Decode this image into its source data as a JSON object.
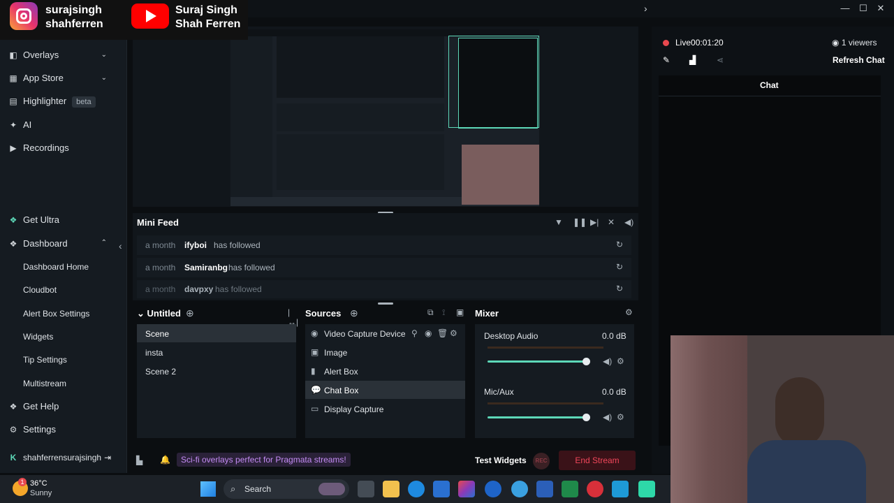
{
  "overlay": {
    "instagram_name": [
      "surajsingh",
      "shahferren"
    ],
    "youtube_name": [
      "Suraj Singh",
      "Shah Ferren"
    ]
  },
  "window": {
    "min": "—",
    "max": "☐",
    "close": "✕"
  },
  "sidebar": {
    "items": [
      {
        "label": "Overlays",
        "icon": "overlays-icon"
      },
      {
        "label": "App Store",
        "icon": "app-store-icon"
      },
      {
        "label": "Highlighter",
        "icon": "highlighter-icon",
        "badge": "beta"
      },
      {
        "label": "AI",
        "icon": "ai-sparkle-icon"
      },
      {
        "label": "Recordings",
        "icon": "recordings-icon"
      }
    ],
    "bottom": {
      "get_ultra": "Get Ultra",
      "dashboard": "Dashboard",
      "sub": [
        "Dashboard Home",
        "Cloudbot",
        "Alert Box Settings",
        "Widgets",
        "Tip Settings",
        "Multistream"
      ],
      "get_help": "Get Help",
      "settings": "Settings",
      "user": "shahferrensurajsingh"
    }
  },
  "mini_feed": {
    "title": "Mini Feed",
    "events": [
      {
        "time": "a month",
        "user": "ifyboi",
        "action": "has followed"
      },
      {
        "time": "a month",
        "user": "Samiranbg",
        "action": "has followed"
      },
      {
        "time": "a month",
        "user": "davpxy",
        "action": "has followed"
      }
    ]
  },
  "scenes": {
    "title": "Untitled",
    "items": [
      "Scene",
      "insta",
      "Scene 2"
    ],
    "selected": 0
  },
  "sources": {
    "title": "Sources",
    "items": [
      {
        "label": "Video Capture Device",
        "icon": "webcam-icon"
      },
      {
        "label": "Image",
        "icon": "image-icon"
      },
      {
        "label": "Alert Box",
        "icon": "alert-box-icon"
      },
      {
        "label": "Chat Box",
        "icon": "chat-icon"
      },
      {
        "label": "Display Capture",
        "icon": "monitor-icon"
      }
    ],
    "selected": 3
  },
  "mixer": {
    "title": "Mixer",
    "channels": [
      {
        "name": "Desktop Audio",
        "db": "0.0 dB",
        "level": 1.0
      },
      {
        "name": "Mic/Aux",
        "db": "0.0 dB",
        "level": 1.0
      }
    ]
  },
  "footer": {
    "promo": "Sci-fi overlays perfect for Pragmata streams!",
    "test_widgets": "Test Widgets",
    "rec": "REC",
    "end_stream": "End Stream"
  },
  "right_panel": {
    "live_label": "Live",
    "live_time": "00:01:20",
    "viewers": "1 viewers",
    "refresh_chat": "Refresh Chat",
    "chat_title": "Chat"
  },
  "taskbar": {
    "temp": "36°C",
    "weather": "Sunny",
    "weather_badge": "1",
    "search": "Search"
  },
  "colors": {
    "accent": "#5dd8b8",
    "live_red": "#e8484e",
    "end_stream_bg": "#3a1218",
    "end_stream_text": "#f0465a"
  }
}
